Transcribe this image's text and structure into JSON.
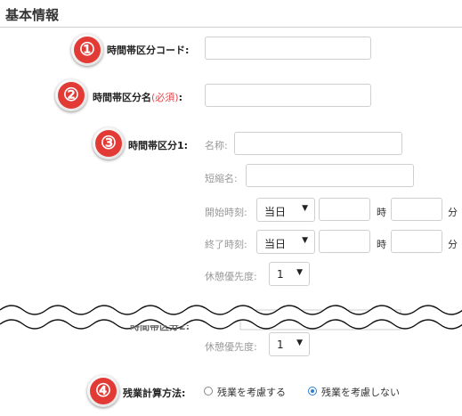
{
  "section": {
    "title": "基本情報"
  },
  "badges": [
    "①",
    "②",
    "③",
    "④"
  ],
  "fields": {
    "code_label": "時間帯区分コード:",
    "name_label": "時間帯区分名",
    "name_required": "(必須)",
    "name_colon": ":",
    "slot1_label": "時間帯区分1:",
    "slot2_label_partial": "時間帯区分2:"
  },
  "slot1": {
    "name_label": "名称:",
    "short_label": "短縮名:",
    "start_label": "開始時刻:",
    "end_label": "終了時刻:",
    "break_label": "休憩優先度:",
    "start_day": "当日",
    "end_day": "当日",
    "hour_unit": "時",
    "minute_unit": "分",
    "break_value": "1"
  },
  "slot2": {
    "break_label": "休憩優先度:",
    "break_value": "1"
  },
  "overtime": {
    "label": "残業計算方法:",
    "options": [
      {
        "label": "残業を考慮する",
        "selected": false
      },
      {
        "label": "残業を考慮しない",
        "selected": true
      }
    ]
  },
  "caret": "▼"
}
